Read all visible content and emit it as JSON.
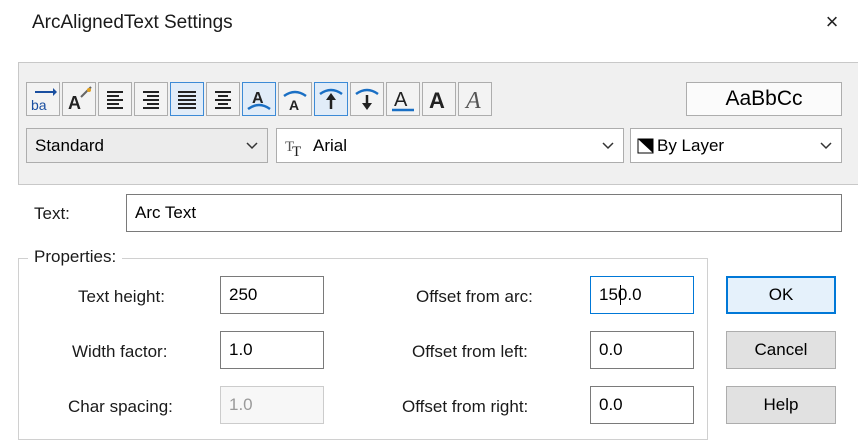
{
  "window": {
    "title": "ArcAlignedText Settings",
    "close_glyph": "×"
  },
  "toolbar": {
    "icons": [
      {
        "name": "reverse-text-icon",
        "selected": false
      },
      {
        "name": "drag-wizard-icon",
        "selected": false
      },
      {
        "name": "align-left-icon",
        "selected": false
      },
      {
        "name": "align-right-icon",
        "selected": false
      },
      {
        "name": "align-fit-icon",
        "selected": true
      },
      {
        "name": "align-center-icon",
        "selected": false
      },
      {
        "name": "convex-side-icon",
        "selected": true
      },
      {
        "name": "concave-side-icon",
        "selected": false
      },
      {
        "name": "outward-direction-icon",
        "selected": true
      },
      {
        "name": "inward-direction-icon",
        "selected": false
      },
      {
        "name": "underline-icon",
        "selected": false
      },
      {
        "name": "bold-icon",
        "selected": false
      },
      {
        "name": "italic-icon",
        "selected": false
      }
    ],
    "sample_text": "AaBbCc"
  },
  "style_select": {
    "value": "Standard"
  },
  "font_select": {
    "value": "Arial",
    "font_icon": "TrueType"
  },
  "color_select": {
    "value": "By Layer"
  },
  "text": {
    "label": "Text:",
    "value": "Arc Text"
  },
  "properties": {
    "label": "Properties:",
    "text_height": {
      "label": "Text height:",
      "value": "250"
    },
    "width_factor": {
      "label": "Width factor:",
      "value": "1.0"
    },
    "char_spacing": {
      "label": "Char spacing:",
      "value": "1.0",
      "enabled": false
    },
    "offset_from_arc": {
      "label": "Offset from arc:",
      "value": "150.0"
    },
    "offset_from_left": {
      "label": "Offset from left:",
      "value": "0.0"
    },
    "offset_from_right": {
      "label": "Offset from right:",
      "value": "0.0"
    }
  },
  "buttons": {
    "ok": "OK",
    "cancel": "Cancel",
    "help": "Help"
  },
  "colors": {
    "accent": "#0078d7",
    "selected_bg": "#e1ecf8",
    "panel": "#f0f0f0"
  }
}
